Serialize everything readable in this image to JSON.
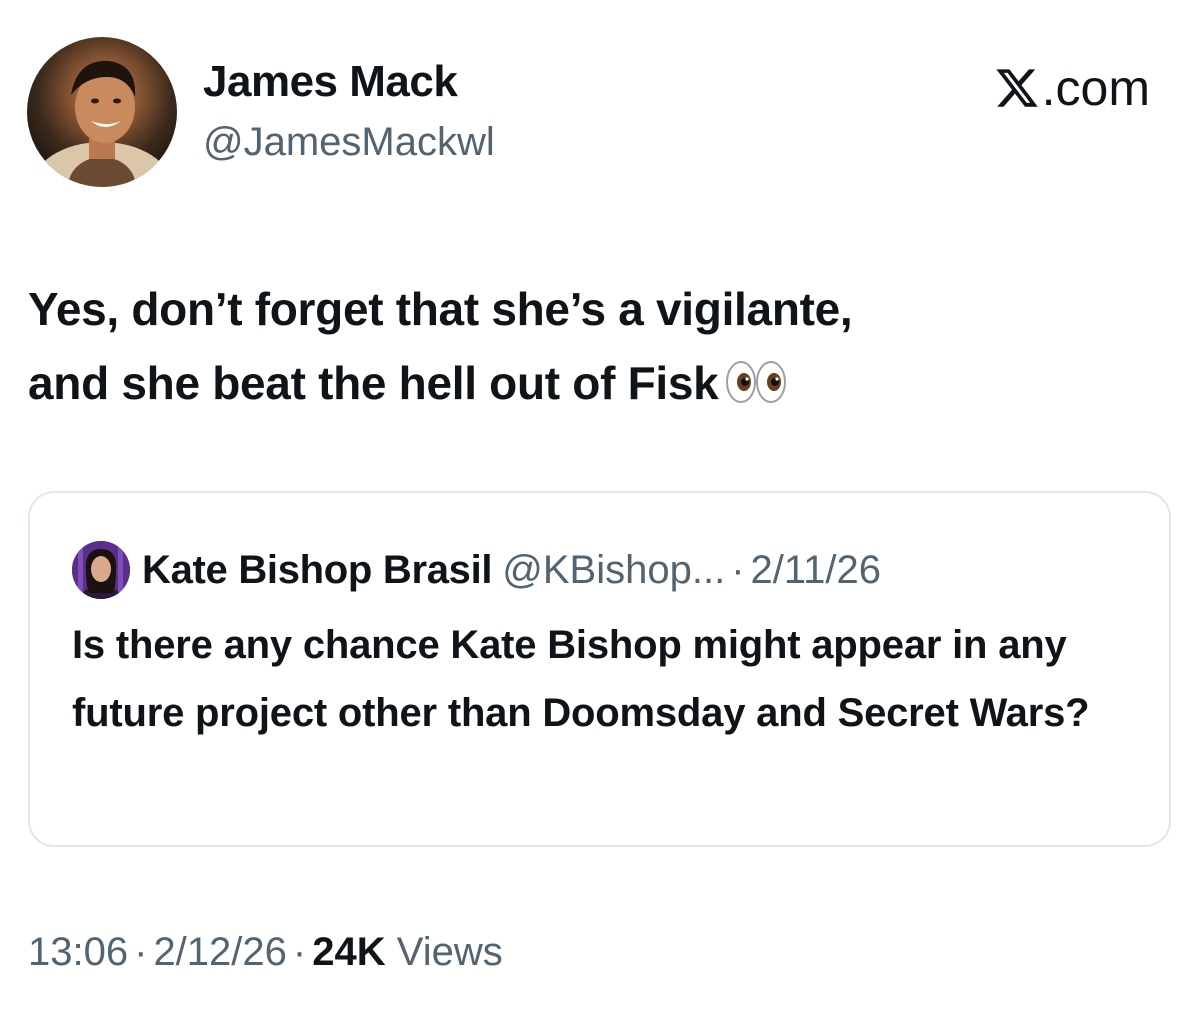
{
  "author": {
    "display_name": "James Mack",
    "handle": "@JamesMackwl",
    "avatar_icon": "profile-photo-avatar"
  },
  "brand": {
    "label": ".com",
    "logo_icon": "x-logo-icon"
  },
  "tweet": {
    "text_line1": "Yes, don’t forget that she’s a vigilante,",
    "text_line2": "and she beat the hell out of Fisk",
    "emoji_icon": "eyes-emoji-icon"
  },
  "quoted_tweet": {
    "display_name": "Kate Bishop Brasil",
    "handle": "@KBishop...",
    "separator": "·",
    "date": "2/11/26",
    "text": "Is there any chance Kate Bishop might appear in any future project other than Doomsday and Secret Wars?",
    "avatar_icon": "profile-photo-avatar"
  },
  "meta": {
    "time": "13:06",
    "separator": "·",
    "date": "2/12/26",
    "views_count": "24K",
    "views_label": "Views"
  },
  "colors": {
    "text_primary": "#0f1419",
    "text_secondary": "#536471",
    "card_border": "#e1e6ea"
  }
}
